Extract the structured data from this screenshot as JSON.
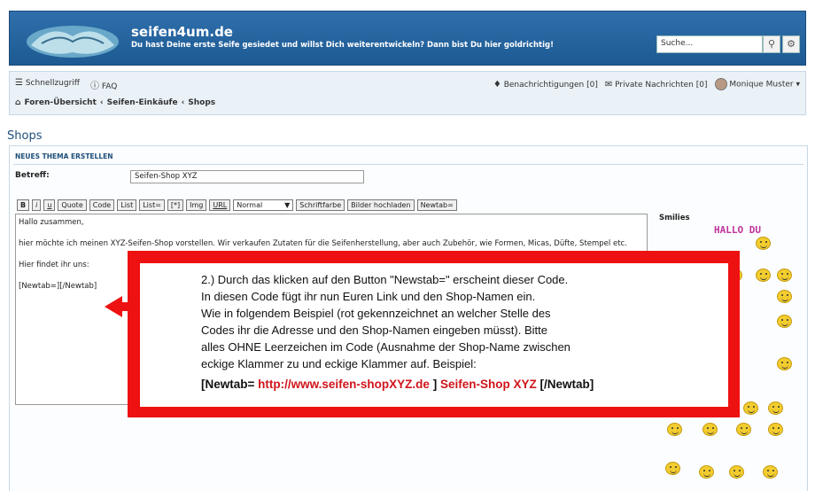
{
  "header": {
    "site_title": "seifen4um.de",
    "subtitle": "Du hast Deine erste Seife gesiedet und willst Dich weiterentwickeln? Dann bist Du hier goldrichtig!",
    "search_placeholder": "Suche..."
  },
  "nav": {
    "quick_access": "Schnellzugriff",
    "faq": "FAQ",
    "notifications": "Benachrichtigungen [0]",
    "messages": "Private Nachrichten [0]",
    "user": "Monique Muster",
    "breadcrumb": [
      "Foren-Übersicht",
      "Seifen-Einkäufe",
      "Shops"
    ]
  },
  "page_title": "Shops",
  "form": {
    "heading": "NEUES THEMA ERSTELLEN",
    "subject_label": "Betreff:",
    "subject_value": "Seifen-Shop XYZ",
    "toolbar": [
      "B",
      "i",
      "u",
      "Quote",
      "Code",
      "List",
      "List=",
      "[*]",
      "Img",
      "URL"
    ],
    "font_size": "Normal",
    "toolbar_after": [
      "Schriftfarbe",
      "Bilder hochladen",
      "Newtab="
    ],
    "editor_lines": [
      "Hallo zusammen,",
      "hier möchte ich meinen XYZ-Seifen-Shop vorstellen. Wir verkaufen Zutaten für die Seifenherstellung, aber auch Zubehör, wie Formen, Micas, Düfte, Stempel etc.",
      "Hier findet ihr uns:",
      "[Newtab=][/Newtab]"
    ],
    "smilies_label": "Smilies",
    "smiley_banner": "HALLO DU"
  },
  "callout": {
    "lines": [
      "2.) Durch das klicken auf den Button \"Newstab=\" erscheint dieser Code.",
      "In diesen Code fügt ihr nun Euren Link und den Shop-Namen ein.",
      "Wie in folgendem Beispiel (rot gekennzeichnet an welcher Stelle des",
      "Codes ihr die Adresse und den Shop-Namen eingeben müsst). Bitte",
      "alles OHNE Leerzeichen im Code (Ausnahme der Shop-Name zwischen",
      "eckige Klammer zu und eckige Klammer auf. Beispiel:"
    ],
    "code_open": "[Newtab=",
    "code_url": "http://www.seifen-shopXYZ.de",
    "code_mid": "]",
    "code_name": "Seifen-Shop XYZ",
    "code_close": "[/Newtab]"
  },
  "colors": {
    "header_bg": "#2f6fab",
    "callout_red": "#e11111",
    "link_red": "#d0141b"
  }
}
